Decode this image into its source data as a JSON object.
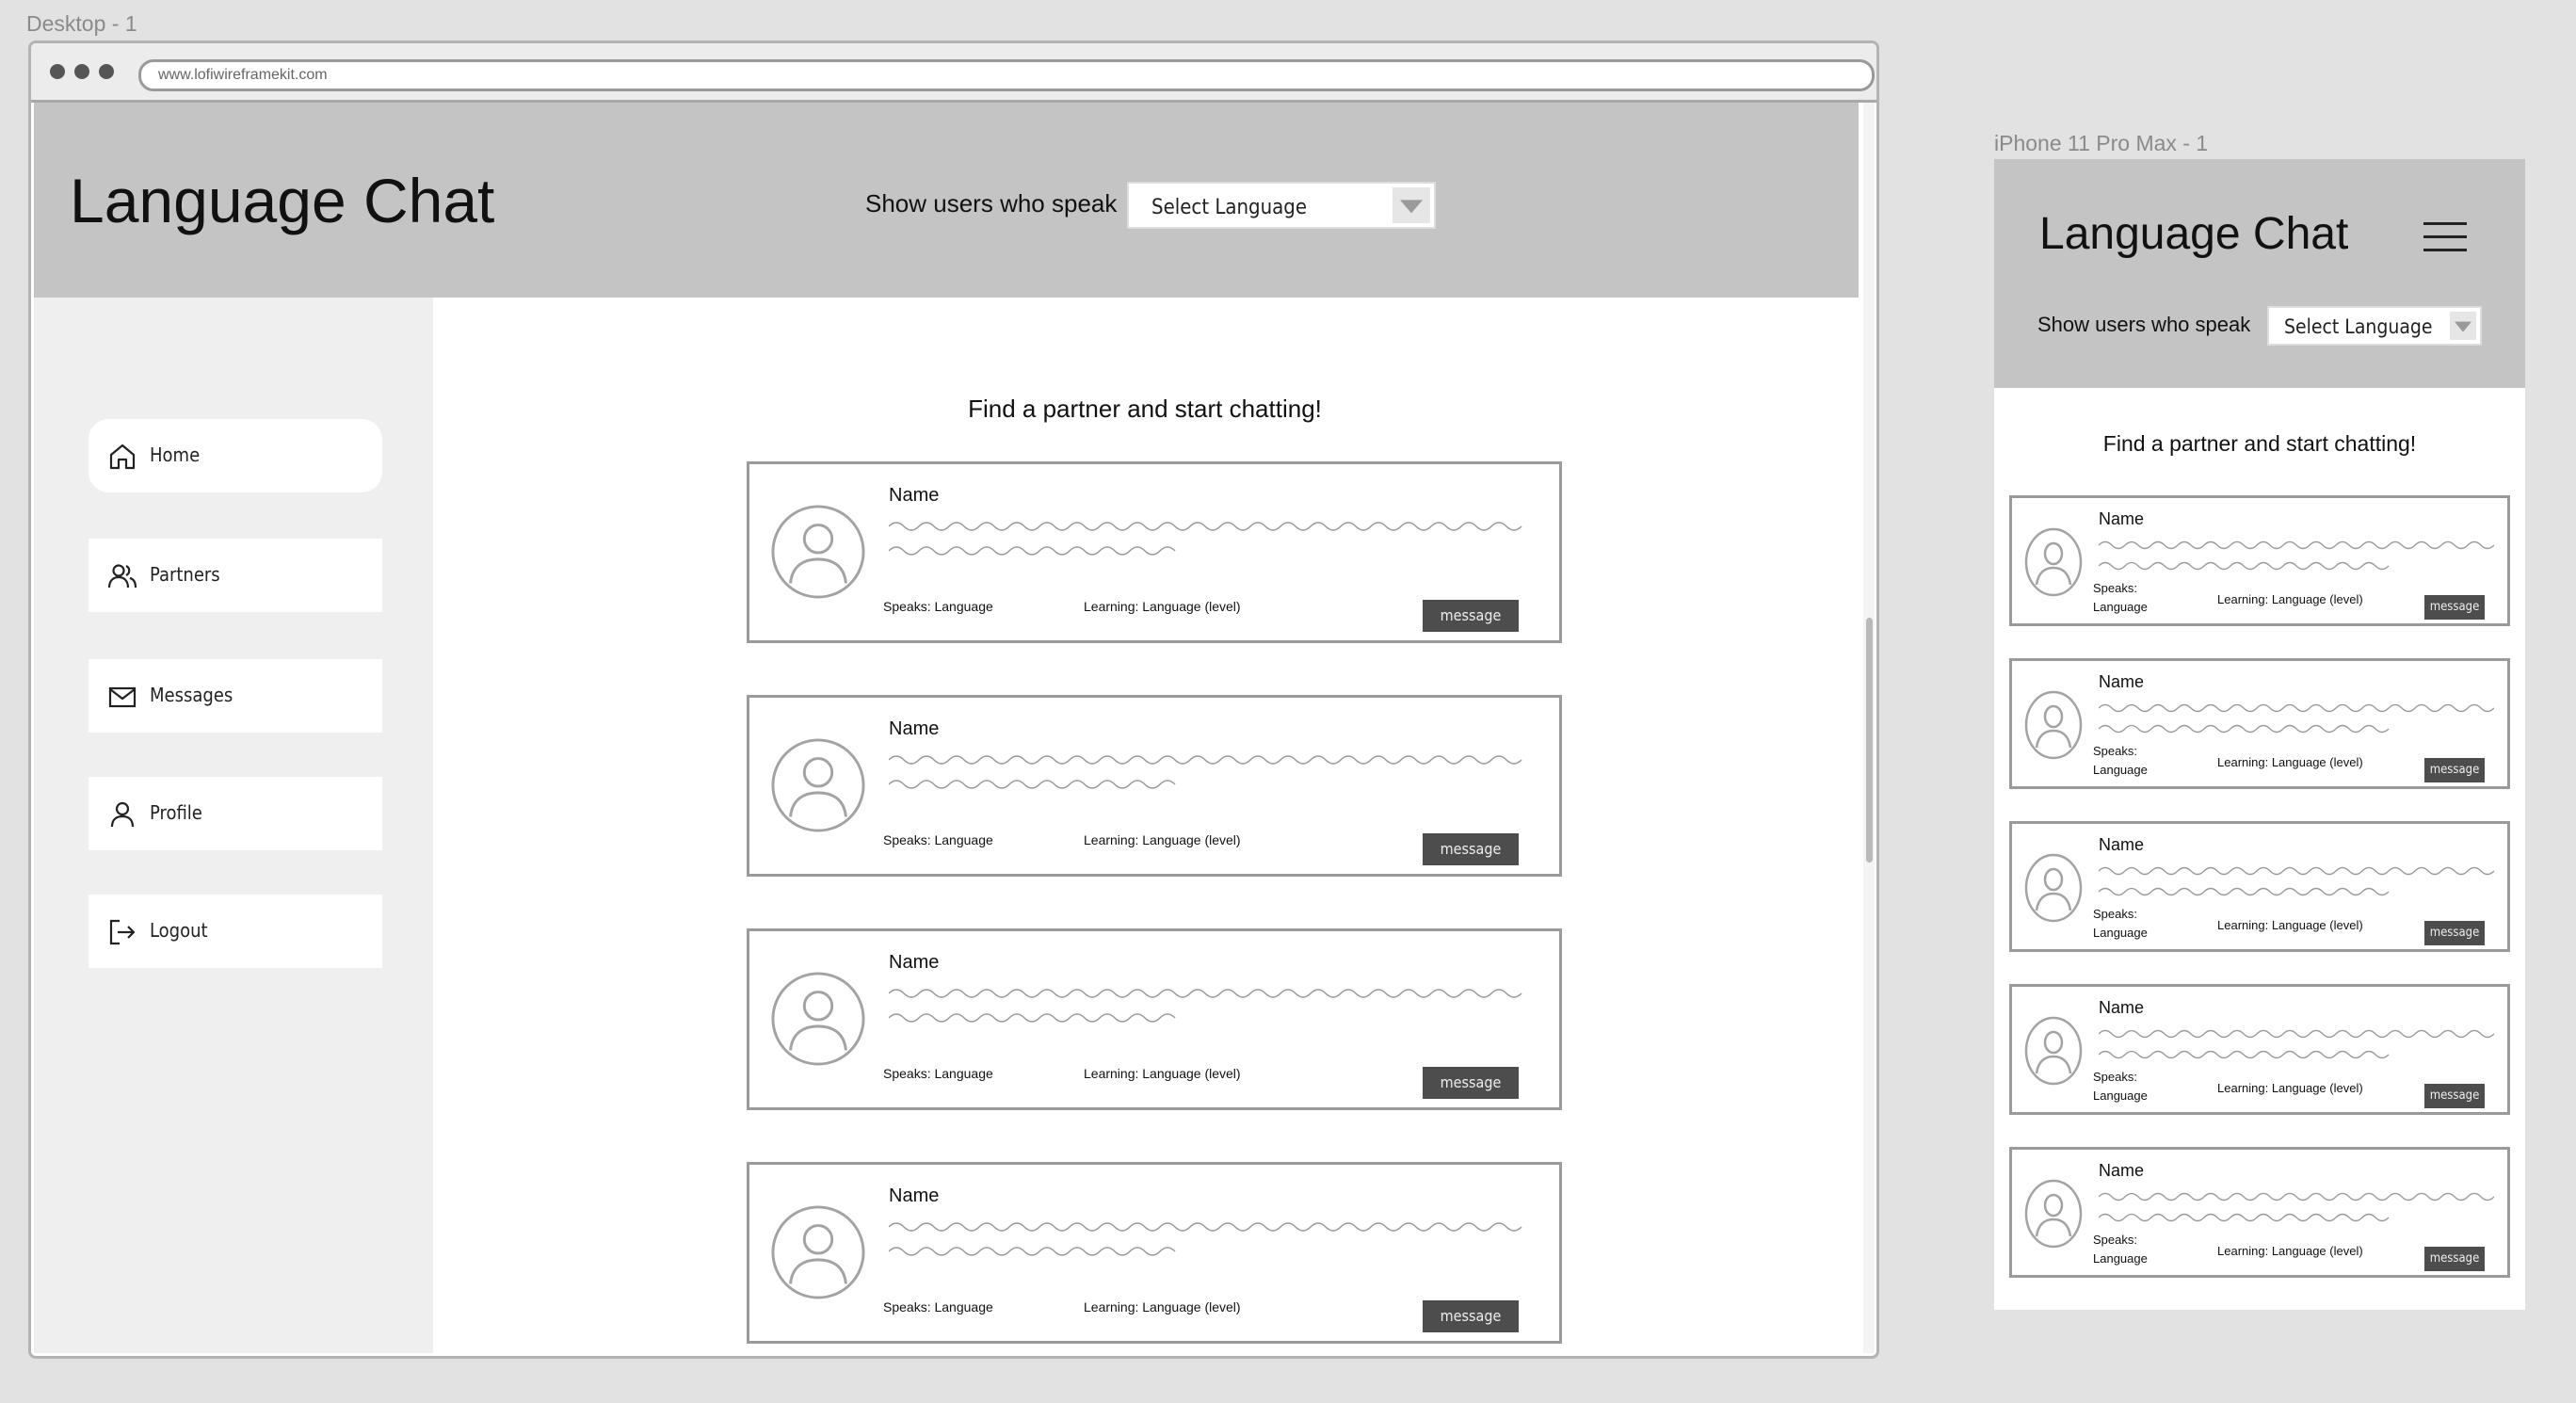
{
  "frames": {
    "desktop_label": "Desktop - 1",
    "mobile_label": "iPhone 11 Pro Max - 1"
  },
  "browser": {
    "url": "www.lofiwireframekit.com"
  },
  "app": {
    "title": "Language Chat",
    "filter_label": "Show users who speak",
    "select_placeholder": "Select Language",
    "heading": "Find a partner and start chatting!"
  },
  "nav": {
    "items": [
      {
        "label": "Home",
        "icon": "home-icon",
        "active": true
      },
      {
        "label": "Partners",
        "icon": "users-icon",
        "active": false
      },
      {
        "label": "Messages",
        "icon": "envelope-icon",
        "active": false
      },
      {
        "label": "Profile",
        "icon": "user-icon",
        "active": false
      },
      {
        "label": "Logout",
        "icon": "logout-icon",
        "active": false
      }
    ]
  },
  "partners": {
    "desktop": [
      {
        "name": "Name",
        "speaks": "Speaks: Language",
        "learning": "Learning: Language (level)",
        "action": "message"
      },
      {
        "name": "Name",
        "speaks": "Speaks: Language",
        "learning": "Learning: Language (level)",
        "action": "message"
      },
      {
        "name": "Name",
        "speaks": "Speaks: Language",
        "learning": "Learning: Language (level)",
        "action": "message"
      },
      {
        "name": "Name",
        "speaks": "Speaks: Language",
        "learning": "Learning: Language (level)",
        "action": "message"
      }
    ],
    "mobile": [
      {
        "name": "Name",
        "speaks_label": "Speaks:",
        "speaks_value": "Language",
        "learning": "Learning: Language (level)",
        "action": "message"
      },
      {
        "name": "Name",
        "speaks_label": "Speaks:",
        "speaks_value": "Language",
        "learning": "Learning: Language (level)",
        "action": "message"
      },
      {
        "name": "Name",
        "speaks_label": "Speaks:",
        "speaks_value": "Language",
        "learning": "Learning: Language (level)",
        "action": "message"
      },
      {
        "name": "Name",
        "speaks_label": "Speaks:",
        "speaks_value": "Language",
        "learning": "Learning: Language (level)",
        "action": "message"
      },
      {
        "name": "Name",
        "speaks_label": "Speaks:",
        "speaks_value": "Language",
        "learning": "Learning: Language (level)",
        "action": "message"
      }
    ]
  },
  "colors": {
    "header_bg": "#c4c4c4",
    "sidebar_bg": "#efefef",
    "button_bg": "#4d4d4d",
    "card_border": "#9a9a9a"
  }
}
